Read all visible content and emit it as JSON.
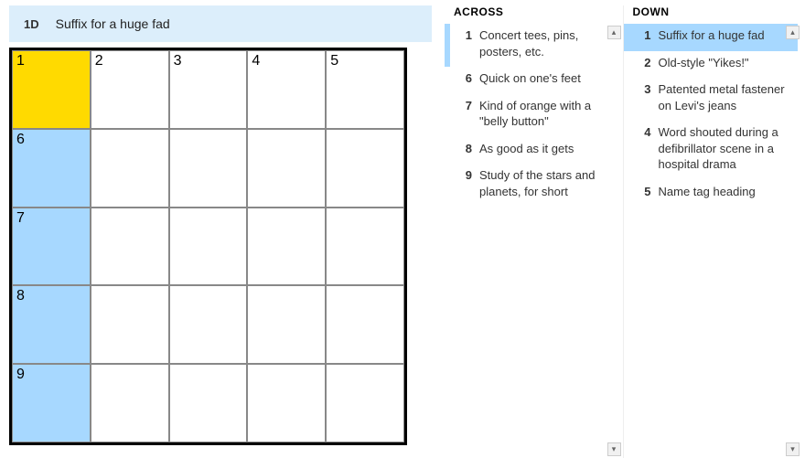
{
  "current_clue": {
    "label": "1D",
    "text": "Suffix for a huge fad"
  },
  "grid": {
    "size": 5,
    "cells": [
      {
        "r": 0,
        "c": 0,
        "num": "1",
        "state": "sel"
      },
      {
        "r": 0,
        "c": 1,
        "num": "2",
        "state": ""
      },
      {
        "r": 0,
        "c": 2,
        "num": "3",
        "state": ""
      },
      {
        "r": 0,
        "c": 3,
        "num": "4",
        "state": ""
      },
      {
        "r": 0,
        "c": 4,
        "num": "5",
        "state": ""
      },
      {
        "r": 1,
        "c": 0,
        "num": "6",
        "state": "hl"
      },
      {
        "r": 1,
        "c": 1,
        "num": "",
        "state": ""
      },
      {
        "r": 1,
        "c": 2,
        "num": "",
        "state": ""
      },
      {
        "r": 1,
        "c": 3,
        "num": "",
        "state": ""
      },
      {
        "r": 1,
        "c": 4,
        "num": "",
        "state": ""
      },
      {
        "r": 2,
        "c": 0,
        "num": "7",
        "state": "hl"
      },
      {
        "r": 2,
        "c": 1,
        "num": "",
        "state": ""
      },
      {
        "r": 2,
        "c": 2,
        "num": "",
        "state": ""
      },
      {
        "r": 2,
        "c": 3,
        "num": "",
        "state": ""
      },
      {
        "r": 2,
        "c": 4,
        "num": "",
        "state": ""
      },
      {
        "r": 3,
        "c": 0,
        "num": "8",
        "state": "hl"
      },
      {
        "r": 3,
        "c": 1,
        "num": "",
        "state": ""
      },
      {
        "r": 3,
        "c": 2,
        "num": "",
        "state": ""
      },
      {
        "r": 3,
        "c": 3,
        "num": "",
        "state": ""
      },
      {
        "r": 3,
        "c": 4,
        "num": "",
        "state": ""
      },
      {
        "r": 4,
        "c": 0,
        "num": "9",
        "state": "hl"
      },
      {
        "r": 4,
        "c": 1,
        "num": "",
        "state": ""
      },
      {
        "r": 4,
        "c": 2,
        "num": "",
        "state": ""
      },
      {
        "r": 4,
        "c": 3,
        "num": "",
        "state": ""
      },
      {
        "r": 4,
        "c": 4,
        "num": "",
        "state": ""
      }
    ]
  },
  "across": {
    "heading": "ACROSS",
    "clues": [
      {
        "num": "1",
        "text": "Concert tees, pins, posters, etc.",
        "state": "rel"
      },
      {
        "num": "6",
        "text": "Quick on one's feet",
        "state": ""
      },
      {
        "num": "7",
        "text": "Kind of orange with a \"belly button\"",
        "state": ""
      },
      {
        "num": "8",
        "text": "As good as it gets",
        "state": ""
      },
      {
        "num": "9",
        "text": "Study of the stars and planets, for short",
        "state": ""
      }
    ]
  },
  "down": {
    "heading": "DOWN",
    "clues": [
      {
        "num": "1",
        "text": "Suffix for a huge fad",
        "state": "sel"
      },
      {
        "num": "2",
        "text": "Old-style \"Yikes!\"",
        "state": ""
      },
      {
        "num": "3",
        "text": "Patented metal fastener on Levi's jeans",
        "state": ""
      },
      {
        "num": "4",
        "text": "Word shouted during a defibrillator scene in a hospital drama",
        "state": ""
      },
      {
        "num": "5",
        "text": "Name tag heading",
        "state": ""
      }
    ]
  },
  "scroll_glyphs": {
    "up": "▴",
    "down": "▾"
  }
}
